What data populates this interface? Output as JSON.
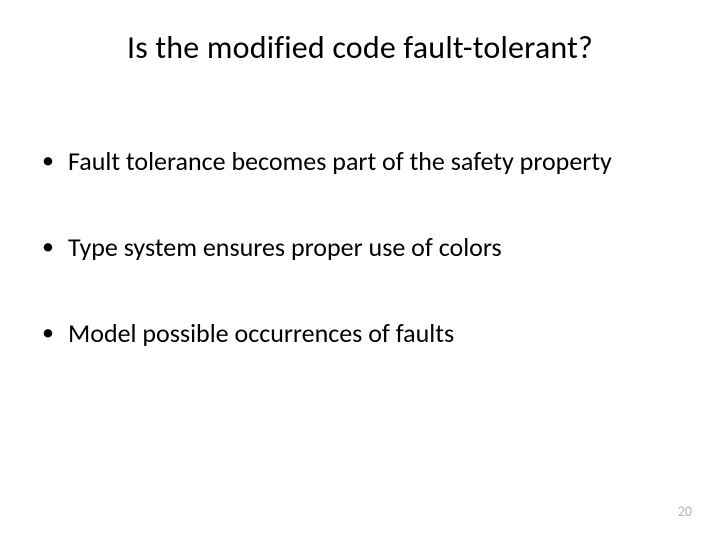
{
  "title": "Is the modified code fault-tolerant?",
  "bullets": [
    "Fault tolerance becomes part of the safety property",
    "Type system ensures proper use of colors",
    "Model possible occurrences of faults"
  ],
  "pageNumber": "20"
}
